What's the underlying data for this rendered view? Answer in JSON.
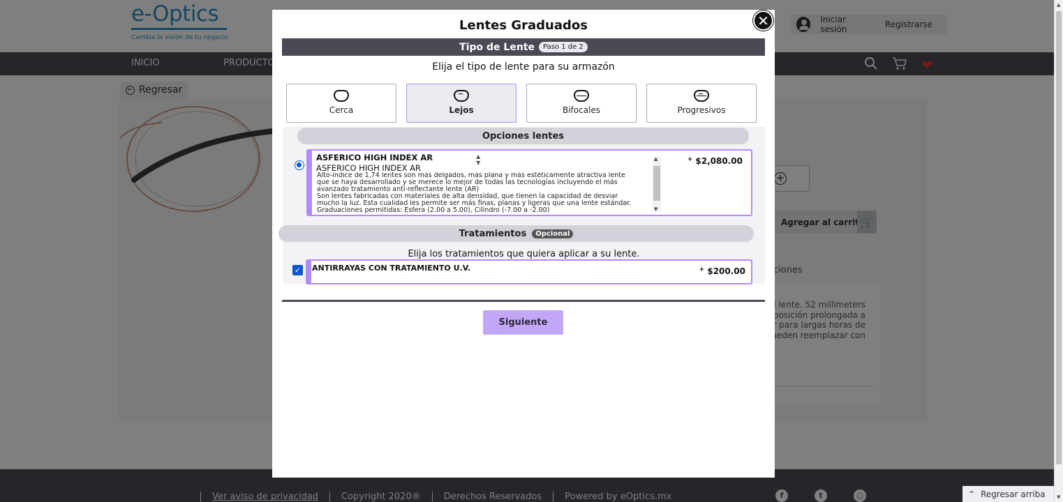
{
  "header": {
    "logo_text": "e-Optics",
    "logo_tagline": "Cambia la visión de tu negocio",
    "login_label": "Iniciar sesión",
    "register_label": "Registrarse"
  },
  "nav": {
    "items": [
      "INICIO",
      "PRODUCTOS"
    ],
    "icons": [
      "search-icon",
      "cart-icon",
      "heart-icon"
    ]
  },
  "page": {
    "back_label": "Regresar",
    "add_to_cart_label": "Agregar al carrito",
    "tab_partial": "ciones",
    "description_partial": "l lente. 52 millimeters\nposición prolongada a\nor para largas horas de\nueden reemplazar con"
  },
  "footer": {
    "privacy_link": "Ver aviso de privacidad",
    "copyright": "Copyright 2020®",
    "rights": "Derechos Reservados",
    "powered": "Powered by eOptics.mx",
    "social": [
      "facebook-icon",
      "twitter-icon",
      "instagram-icon"
    ],
    "back_to_top": "Regresar arriba"
  },
  "modal": {
    "title": "Lentes Graduados",
    "step_title": "Tipo de Lente",
    "step_badge": "Paso 1 de 2",
    "lens_prompt": "Elija el tipo de lente para su armazón",
    "lens_types": [
      {
        "label": "Cerca",
        "selected": false
      },
      {
        "label": "Lejos",
        "selected": true
      },
      {
        "label": "Bifocales",
        "selected": false
      },
      {
        "label": "Progresivos",
        "selected": false
      }
    ],
    "options_header": "Opciones lentes",
    "option": {
      "title": "ASFERICO HIGH INDEX AR",
      "subtitle": "ASFERICO HIGH INDEX AR",
      "description": "Alto-índice de 1,74 lentes son más delgados, más plana y más estéticamente atractiva lente\nque se haya desarrollado y se merece lo mejor de todas las tecnologías incluyendo el más\navanzado tratamiento anti-reflectante lente (AR)\nSon lentes fabricadas con materiales de alta densidad, que tienen la capacidad de desviar\nmucho la luz. Esta cualidad les permite ser más finas, planas y ligeras que una lente estándar.\nGraduaciones permitidas: Esfera (2.00 a 5.00), Cilindro (-7.00 a -2.00)",
      "price_sign": "+",
      "price": "$2,080.00",
      "selected": true
    },
    "treatments_header": "Tratamientos",
    "treatments_badge": "Opcional",
    "treatments_prompt": "Elija los tratamientos que quiera aplicar a su lente.",
    "treatment": {
      "name": "ANTIRRAYAS CON TRATAMIENTO U.V.",
      "price_sign": "+",
      "price": "$200.00",
      "checked": true
    },
    "next_label": "Siguiente"
  },
  "colors": {
    "brand": "#2d8fc0",
    "nav_bg": "#4a4a55",
    "accent_purple": "#b18bf5",
    "button_purple": "#c3a7f7",
    "heart": "#e53935"
  }
}
